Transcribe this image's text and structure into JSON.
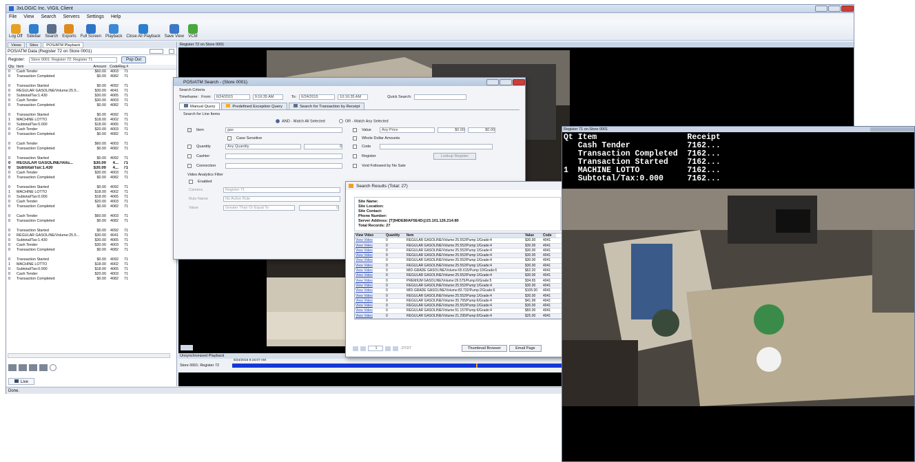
{
  "app": {
    "title": "3xLOGIC Inc. VIGIL Client",
    "menu": [
      "File",
      "View",
      "Search",
      "Servers",
      "Settings",
      "Help"
    ],
    "toolbar": [
      {
        "label": "Log Off",
        "icon": "log-off-icon",
        "color": "#e8a020"
      },
      {
        "label": "Sidebar",
        "icon": "sidebar-icon",
        "color": "#2e7fd0"
      },
      {
        "label": "Search",
        "icon": "search-icon",
        "color": "#5a6f8c"
      },
      {
        "label": "Exports",
        "icon": "exports-icon",
        "color": "#e08a1e"
      },
      {
        "label": "Full Screen",
        "icon": "full-screen-icon",
        "color": "#2f73c8"
      },
      {
        "label": "Playback",
        "icon": "playback-icon",
        "color": "#3a8ad8"
      },
      {
        "label": "Close All Playback",
        "icon": "close-playback-icon",
        "color": "#2b7fd0"
      },
      {
        "label": "Save View",
        "icon": "save-view-icon",
        "color": "#3c78c8"
      },
      {
        "label": "VCM",
        "icon": "vcm-icon",
        "color": "#4aa83a"
      }
    ],
    "status": "Done."
  },
  "left_panel": {
    "tabs": [
      "Views",
      "Sites",
      "POS/ATM Playback"
    ],
    "header": "POS/ATM Data (Register 72 on Store 0001)",
    "register_label": "Register:",
    "register_value": "Store 0001: Register 72: Register 71",
    "popout": "Pop Out",
    "columns": [
      "Qty.",
      "Item",
      "Amount",
      "Code",
      "Reg #"
    ],
    "rows": [
      [
        "0",
        "Cash Tender",
        "$60.00",
        "4003",
        "71",
        false
      ],
      [
        "0",
        "Transaction Completed",
        "$0.00",
        "4082",
        "71",
        false
      ],
      [
        "",
        "",
        "",
        "",
        "",
        false
      ],
      [
        "0",
        "Transaction Started",
        "$0.00",
        "4092",
        "71",
        false
      ],
      [
        "0",
        "REGULAR GASOLINE/Volume:25.5...",
        "$30.00",
        "4041",
        "71",
        false
      ],
      [
        "0",
        "Subtotal/Tax:1.430",
        "$30.00",
        "4065",
        "71",
        false
      ],
      [
        "0",
        "Cash Tender",
        "$30.00",
        "4003",
        "71",
        false
      ],
      [
        "0",
        "Transaction Completed",
        "$0.00",
        "4082",
        "71",
        false
      ],
      [
        "",
        "",
        "",
        "",
        "",
        false
      ],
      [
        "0",
        "Transaction Started",
        "$0.00",
        "4092",
        "71",
        false
      ],
      [
        "1",
        "MACHINE LOTTO",
        "$18.00",
        "4002",
        "71",
        false
      ],
      [
        "0",
        "Subtotal/Tax:0.000",
        "$18.00",
        "4065",
        "71",
        false
      ],
      [
        "0",
        "Cash Tender",
        "$20.00",
        "4003",
        "71",
        false
      ],
      [
        "0",
        "Transaction Completed",
        "$0.00",
        "4082",
        "71",
        false
      ],
      [
        "",
        "",
        "",
        "",
        "",
        false
      ],
      [
        "0",
        "Cash Tender",
        "$60.00",
        "4003",
        "71",
        false
      ],
      [
        "0",
        "Transaction Completed",
        "$0.00",
        "4082",
        "71",
        false
      ],
      [
        "",
        "",
        "",
        "",
        "",
        false
      ],
      [
        "0",
        "Transaction Started",
        "$0.00",
        "4092",
        "71",
        false
      ],
      [
        "0",
        "REGULAR GASOLINE/Volu...",
        "$30.00",
        "4...",
        "71",
        true
      ],
      [
        "0",
        "Subtotal/Tax:1.430",
        "$30.00",
        "4...",
        "71",
        true
      ],
      [
        "0",
        "Cash Tender",
        "$30.00",
        "4003",
        "71",
        false
      ],
      [
        "0",
        "Transaction Completed",
        "$0.00",
        "4082",
        "71",
        false
      ],
      [
        "",
        "",
        "",
        "",
        "",
        false
      ],
      [
        "0",
        "Transaction Started",
        "$0.00",
        "4092",
        "71",
        false
      ],
      [
        "1",
        "MACHINE LOTTO",
        "$18.00",
        "4002",
        "71",
        false
      ],
      [
        "0",
        "Subtotal/Tax:0.000",
        "$18.00",
        "4065",
        "71",
        false
      ],
      [
        "0",
        "Cash Tender",
        "$20.00",
        "4003",
        "71",
        false
      ],
      [
        "0",
        "Transaction Completed",
        "$0.00",
        "4082",
        "71",
        false
      ],
      [
        "",
        "",
        "",
        "",
        "",
        false
      ],
      [
        "0",
        "Cash Tender",
        "$60.00",
        "4003",
        "71",
        false
      ],
      [
        "0",
        "Transaction Completed",
        "$0.00",
        "4082",
        "71",
        false
      ],
      [
        "",
        "",
        "",
        "",
        "",
        false
      ],
      [
        "0",
        "Transaction Started",
        "$0.00",
        "4092",
        "71",
        false
      ],
      [
        "0",
        "REGULAR GASOLINE/Volume:25.5...",
        "$30.00",
        "4041",
        "71",
        false
      ],
      [
        "0",
        "Subtotal/Tax:1.430",
        "$30.00",
        "4065",
        "71",
        false
      ],
      [
        "0",
        "Cash Tender",
        "$30.00",
        "4003",
        "71",
        false
      ],
      [
        "0",
        "Transaction Completed",
        "$0.00",
        "4082",
        "71",
        false
      ],
      [
        "",
        "",
        "",
        "",
        "",
        false
      ],
      [
        "0",
        "Transaction Started",
        "$0.00",
        "4092",
        "71",
        false
      ],
      [
        "1",
        "MACHINE LOTTO",
        "$18.00",
        "4002",
        "71",
        false
      ],
      [
        "0",
        "Subtotal/Tax:0.000",
        "$18.00",
        "4065",
        "71",
        false
      ],
      [
        "0",
        "Cash Tender",
        "$20.00",
        "4003",
        "71",
        false
      ],
      [
        "0",
        "Transaction Completed",
        "$0.00",
        "4082",
        "71",
        false
      ]
    ],
    "live_tab": "Live"
  },
  "main_camera": {
    "title": "Register 72 on Store 0001",
    "playback_label": "Unsynchronized Playback",
    "timeline_time": "6/24/2015 9:15:07 AM",
    "timeline_source": "Store 0001: Register 72"
  },
  "search_dialog": {
    "title": "POS/ATM Search - (Store 0001)",
    "criteria": "Search Criteria",
    "timeframe": "Timeframe:",
    "from_label": "From:",
    "from_date": "6/24/2015",
    "from_time": "9:16:35 AM",
    "to_label": "To:",
    "to_date": "6/24/2015",
    "to_time": "10:16:35 AM",
    "quick_search": "Quick Search:",
    "tabs": [
      "Manual Query",
      "Predefined Exception Query",
      "Search for Transaction by Receipt"
    ],
    "line_items": "Search for Line Items",
    "and_option": "AND - Match All Selected",
    "or_option": "OR - Match Any Selected",
    "item_label": "Item",
    "item_value": "gas",
    "case_sensitive": "Case Sensitive",
    "value_label": "Value",
    "value_option": "Any Price",
    "value_from": "$0.00",
    "value_to": "$0.00",
    "whole_dollar": "Whole Dollar Amounts",
    "quantity_label": "Quantity",
    "quantity_option": "Any Quantity",
    "quantity_value": "0",
    "code_label": "Code",
    "cashier_label": "Cashier",
    "register_label": "Register",
    "lookup_register": "Lookup Register",
    "connection_label": "Connection",
    "void_label": "Void Followed by No Sale",
    "analytics": "Video Analytics Filter",
    "enabled": "Enabled",
    "camera_label": "Camera",
    "camera_value": "Register 71",
    "rule_label": "Rule Name",
    "rule_value": "No Active Rule",
    "va_value_label": "Value",
    "va_value_option": "Greater Than Or Equal To",
    "va_value": "0"
  },
  "results": {
    "title": "Search Results (Total: 27)",
    "site_name": "Site Name:",
    "site_location": "Site Location:",
    "site_contact": "Site Contact:",
    "phone": "Phone Number:",
    "server": "Server Address: [T]94DE80AF5E4D@23.101.126.214:80",
    "total": "Total Records: 27",
    "columns": [
      "View Video",
      "Quantity",
      "Item",
      "Value",
      "Code"
    ],
    "rows": [
      [
        "View Video",
        "0",
        "REGULAR GASOLINE/Volume:25.552/Pump:1/Grade:4",
        "$30.00",
        "4041"
      ],
      [
        "View Video",
        "0",
        "REGULAR GASOLINE/Volume:25.552/Pump:1/Grade:4",
        "$30.00",
        "4041"
      ],
      [
        "View Video",
        "0",
        "REGULAR GASOLINE/Volume:25.552/Pump:1/Grade:4",
        "$30.00",
        "4041"
      ],
      [
        "View Video",
        "0",
        "REGULAR GASOLINE/Volume:25.552/Pump:1/Grade:4",
        "$30.00",
        "4041"
      ],
      [
        "View Video",
        "0",
        "REGULAR GASOLINE/Volume:25.552/Pump:1/Grade:4",
        "$30.00",
        "4041"
      ],
      [
        "View Video",
        "0",
        "REGULAR GASOLINE/Volume:25.552/Pump:1/Grade:4",
        "$30.00",
        "4041"
      ],
      [
        "View Video",
        "0",
        "MID-GRADE GASOLINE/Volume:65.615/Pump:10/Grade:6",
        "$62.20",
        "4041"
      ],
      [
        "View Video",
        "0",
        "REGULAR GASOLINE/Volume:25.552/Pump:1/Grade:4",
        "$30.00",
        "4041"
      ],
      [
        "View Video",
        "0",
        "PREMIUM GASOLINE/Volume:26.575/Pump:6/Grade:5",
        "$34.65",
        "4041"
      ],
      [
        "View Video",
        "0",
        "REGULAR GASOLINE/Volume:25.552/Pump:1/Grade:4",
        "$30.00",
        "4041"
      ],
      [
        "View Video",
        "0",
        "MID-GRADE GASOLINE/Volume:83.732/Pump:2/Grade:6",
        "$105.00",
        "4041"
      ],
      [
        "View Video",
        "0",
        "REGULAR GASOLINE/Volume:25.552/Pump:1/Grade:4",
        "$30.00",
        "4041"
      ],
      [
        "View Video",
        "0",
        "REGULAR GASOLINE/Volume:35.765/Pump:6/Grade:4",
        "$41.99",
        "4041"
      ],
      [
        "View Video",
        "0",
        "REGULAR GASOLINE/Volume:25.552/Pump:1/Grade:4",
        "$30.00",
        "4041"
      ],
      [
        "View Video",
        "0",
        "REGULAR GASOLINE/Volume:51.157/Pump:6/Grade:4",
        "$60.00",
        "4041"
      ],
      [
        "View Video",
        "0",
        "REGULAR GASOLINE/Volume:21.295/Pump:6/Grade:4",
        "$25.00",
        "4041"
      ]
    ],
    "pager_value": "1",
    "pager_total": "-27/27",
    "thumbnail_button": "Thumbnail Browser",
    "email_button": "Email Page"
  },
  "register71": {
    "title": "Register 71 on Store 0001",
    "receipt_lines": [
      "Qt Item                   Receipt",
      "   Cash Tender            7162...",
      "   Transaction Completed  7162...",
      "   Transaction Started    7162...",
      "1  MACHINE LOTTO          7162...",
      "   Subtotal/Tax:0.000     7162..."
    ]
  },
  "colors": {
    "accent": "#2e62c8",
    "title_bar": "#c4d4ea",
    "timeline": "#1538d6",
    "link": "#1b3fb8"
  }
}
